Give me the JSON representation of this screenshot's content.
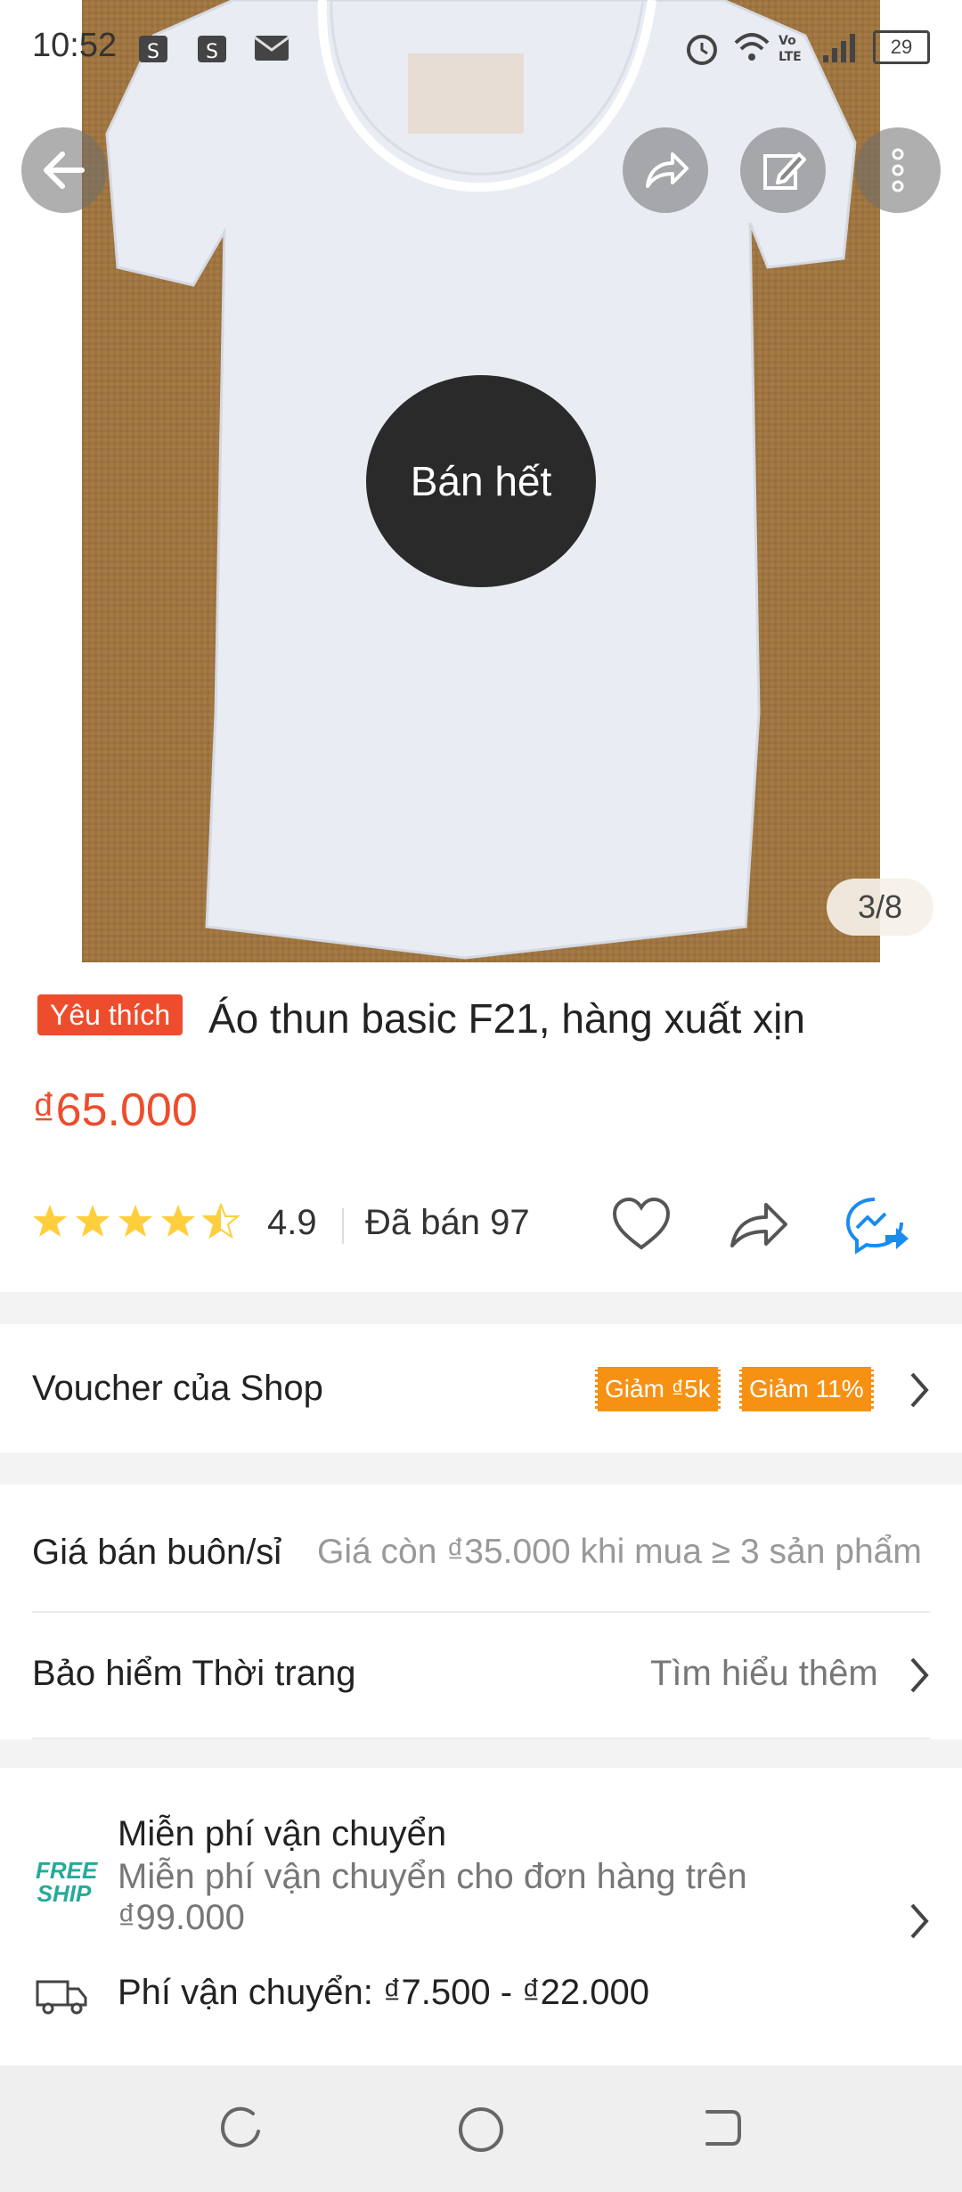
{
  "status_bar": {
    "time": "10:52",
    "battery": "29"
  },
  "product": {
    "sold_out_label": "Bán hết",
    "image_counter": "3/8",
    "badge": "Yêu thích",
    "title": "Áo thun basic F21, hàng xuất xịn",
    "price": "₫65.000",
    "rating": "4.9",
    "rating_stars": 4.5,
    "sold": "Đã bán 97"
  },
  "voucher": {
    "label": "Voucher của Shop",
    "tags": [
      "Giảm ₫5k",
      "Giảm 11%"
    ]
  },
  "wholesale": {
    "label": "Giá bán buôn/sỉ",
    "detail": "Giá còn ₫35.000 khi mua ≥ 3 sản phẩm"
  },
  "insurance": {
    "label": "Bảo hiểm Thời trang",
    "link": "Tìm hiểu thêm"
  },
  "shipping": {
    "free_logo_line1": "FREE",
    "free_logo_line2": "SHIP",
    "free_title": "Miễn phí vận chuyển",
    "free_detail_line1": "Miễn phí vận chuyển cho đơn hàng trên",
    "free_detail_line2": "₫99.000",
    "fee": "Phí vận chuyển: ₫7.500 - ₫22.000"
  },
  "colors": {
    "accent": "#ee4d2d",
    "voucher": "#f69113",
    "messenger": "#1a8cf0",
    "star": "#ffce3d"
  }
}
